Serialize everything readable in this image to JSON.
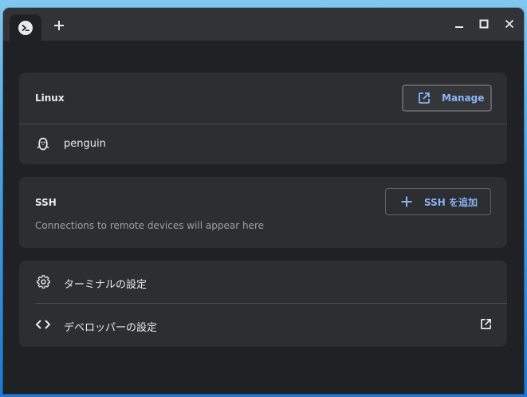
{
  "colors": {
    "window_bg": "#202124",
    "card_bg": "#2d2e31",
    "titlebar_bg": "#323336",
    "accent": "#8ab4f8",
    "text": "#e8eaed",
    "muted": "#9aa0a6"
  },
  "titlebar": {
    "tab_icon": "terminal-icon",
    "new_tab_icon": "plus-icon",
    "controls": [
      "minimize-icon",
      "maximize-icon",
      "close-icon"
    ]
  },
  "linux": {
    "heading": "Linux",
    "manage_label": "Manage",
    "manage_icon": "open-external-icon",
    "container_name": "penguin",
    "container_icon": "penguin-icon"
  },
  "ssh": {
    "heading": "SSH",
    "add_label": "SSH を追加",
    "add_icon": "plus-icon",
    "empty_text": "Connections to remote devices will appear here"
  },
  "settings": {
    "terminal_settings_label": "ターミナルの設定",
    "terminal_settings_icon": "gear-icon",
    "developer_settings_label": "デベロッパーの設定",
    "developer_settings_icon": "code-icon",
    "developer_external_icon": "open-external-icon"
  }
}
